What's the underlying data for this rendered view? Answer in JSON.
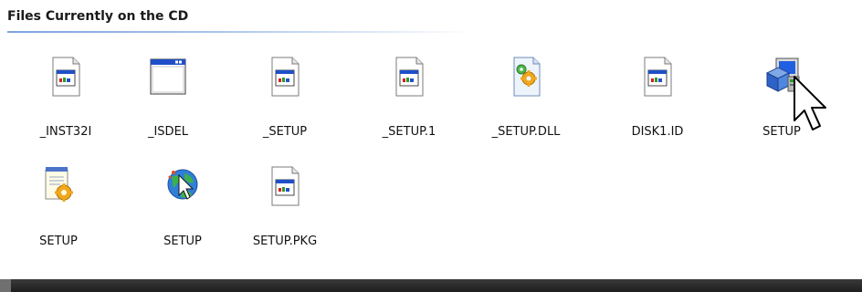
{
  "group": {
    "title": "Files Currently on the CD"
  },
  "files": [
    {
      "label": "_INST32I",
      "icon": "application-file-icon"
    },
    {
      "label": "_ISDEL",
      "icon": "application-window-icon"
    },
    {
      "label": "_SETUP",
      "icon": "application-file-icon"
    },
    {
      "label": "_SETUP.1",
      "icon": "application-file-icon"
    },
    {
      "label": "_SETUP.DLL",
      "icon": "dll-gear-file-icon"
    },
    {
      "label": "DISK1.ID",
      "icon": "application-file-icon"
    },
    {
      "label": "SETUP",
      "icon": "setup-installer-icon"
    },
    {
      "label": "SETUP",
      "icon": "setup-ini-config-icon"
    },
    {
      "label": "SETUP",
      "icon": "internet-shortcut-globe-icon"
    },
    {
      "label": "SETUP.PKG",
      "icon": "application-file-icon"
    }
  ],
  "colors": {
    "header_rule": "#7ca4e0",
    "window_blue": "#1f4fc8",
    "footer_bar": "#2a2a2a"
  }
}
